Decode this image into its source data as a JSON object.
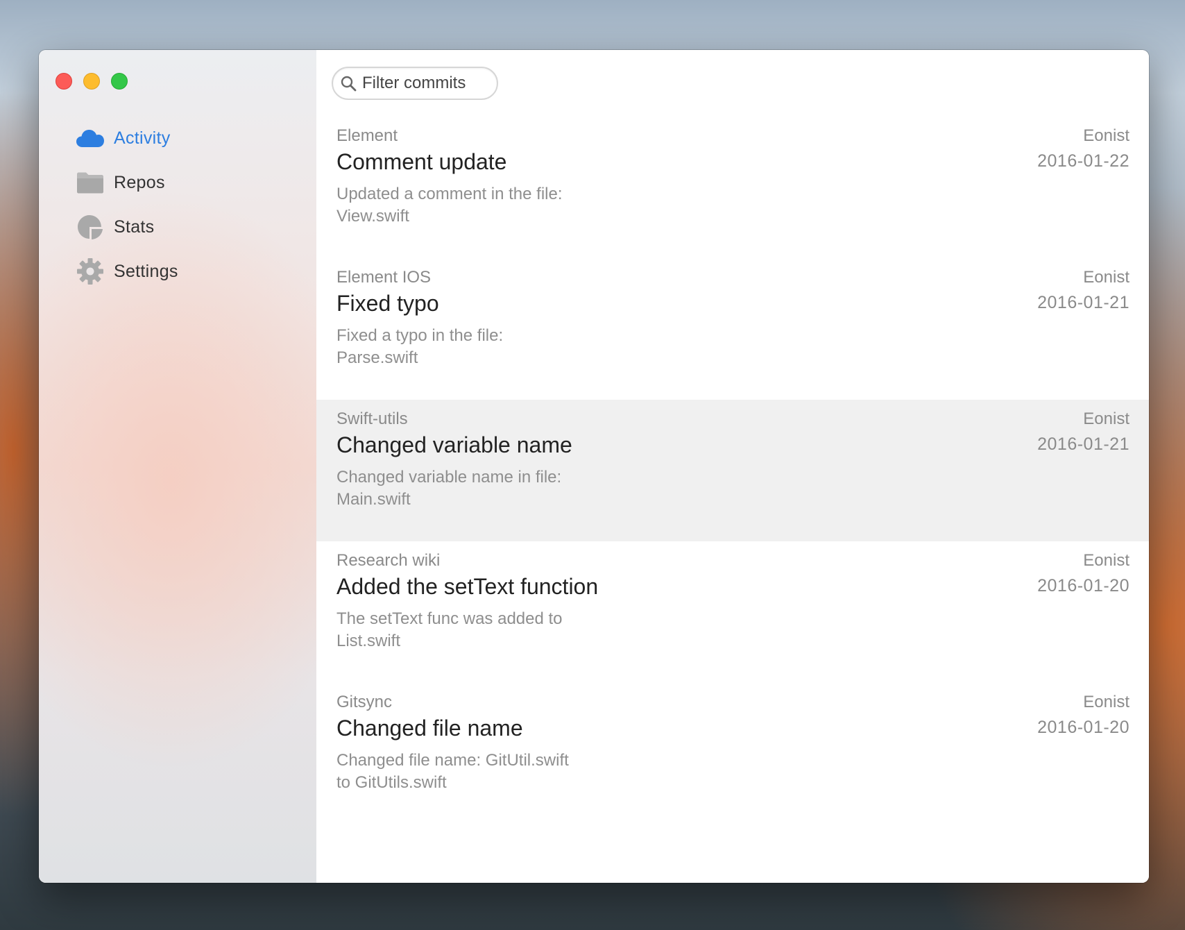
{
  "window": {
    "traffic_lights": [
      "close",
      "minimize",
      "zoom"
    ]
  },
  "sidebar": {
    "items": [
      {
        "label": "Activity",
        "icon": "cloud-icon",
        "active": true
      },
      {
        "label": "Repos",
        "icon": "folder-icon",
        "active": false
      },
      {
        "label": "Stats",
        "icon": "pie-chart-icon",
        "active": false
      },
      {
        "label": "Settings",
        "icon": "gear-icon",
        "active": false
      }
    ]
  },
  "search": {
    "placeholder": "Filter commits",
    "value": ""
  },
  "commits": [
    {
      "repo": "Element",
      "title": "Comment update",
      "description": "Updated a comment in the file: View.swift",
      "author": "Eonist",
      "date": "2016-01-22",
      "selected": false
    },
    {
      "repo": "Element IOS",
      "title": "Fixed typo",
      "description": "Fixed a typo in the file: Parse.swift",
      "author": "Eonist",
      "date": "2016-01-21",
      "selected": false
    },
    {
      "repo": "Swift-utils",
      "title": "Changed variable name",
      "description": "Changed variable name in file: Main.swift",
      "author": "Eonist",
      "date": "2016-01-21",
      "selected": true
    },
    {
      "repo": "Research wiki",
      "title": "Added the setText function",
      "description": "The setText func was added to List.swift",
      "author": "Eonist",
      "date": "2016-01-20",
      "selected": false
    },
    {
      "repo": "Gitsync",
      "title": "Changed file name",
      "description": "Changed file name: GitUtil.swift to GitUtils.swift",
      "author": "Eonist",
      "date": "2016-01-20",
      "selected": false
    }
  ],
  "colors": {
    "accent": "#2d7ee0",
    "selected_row": "#f0f0f0",
    "close": "#fc5b57",
    "minimize": "#fdbc2e",
    "zoom": "#33c748"
  }
}
